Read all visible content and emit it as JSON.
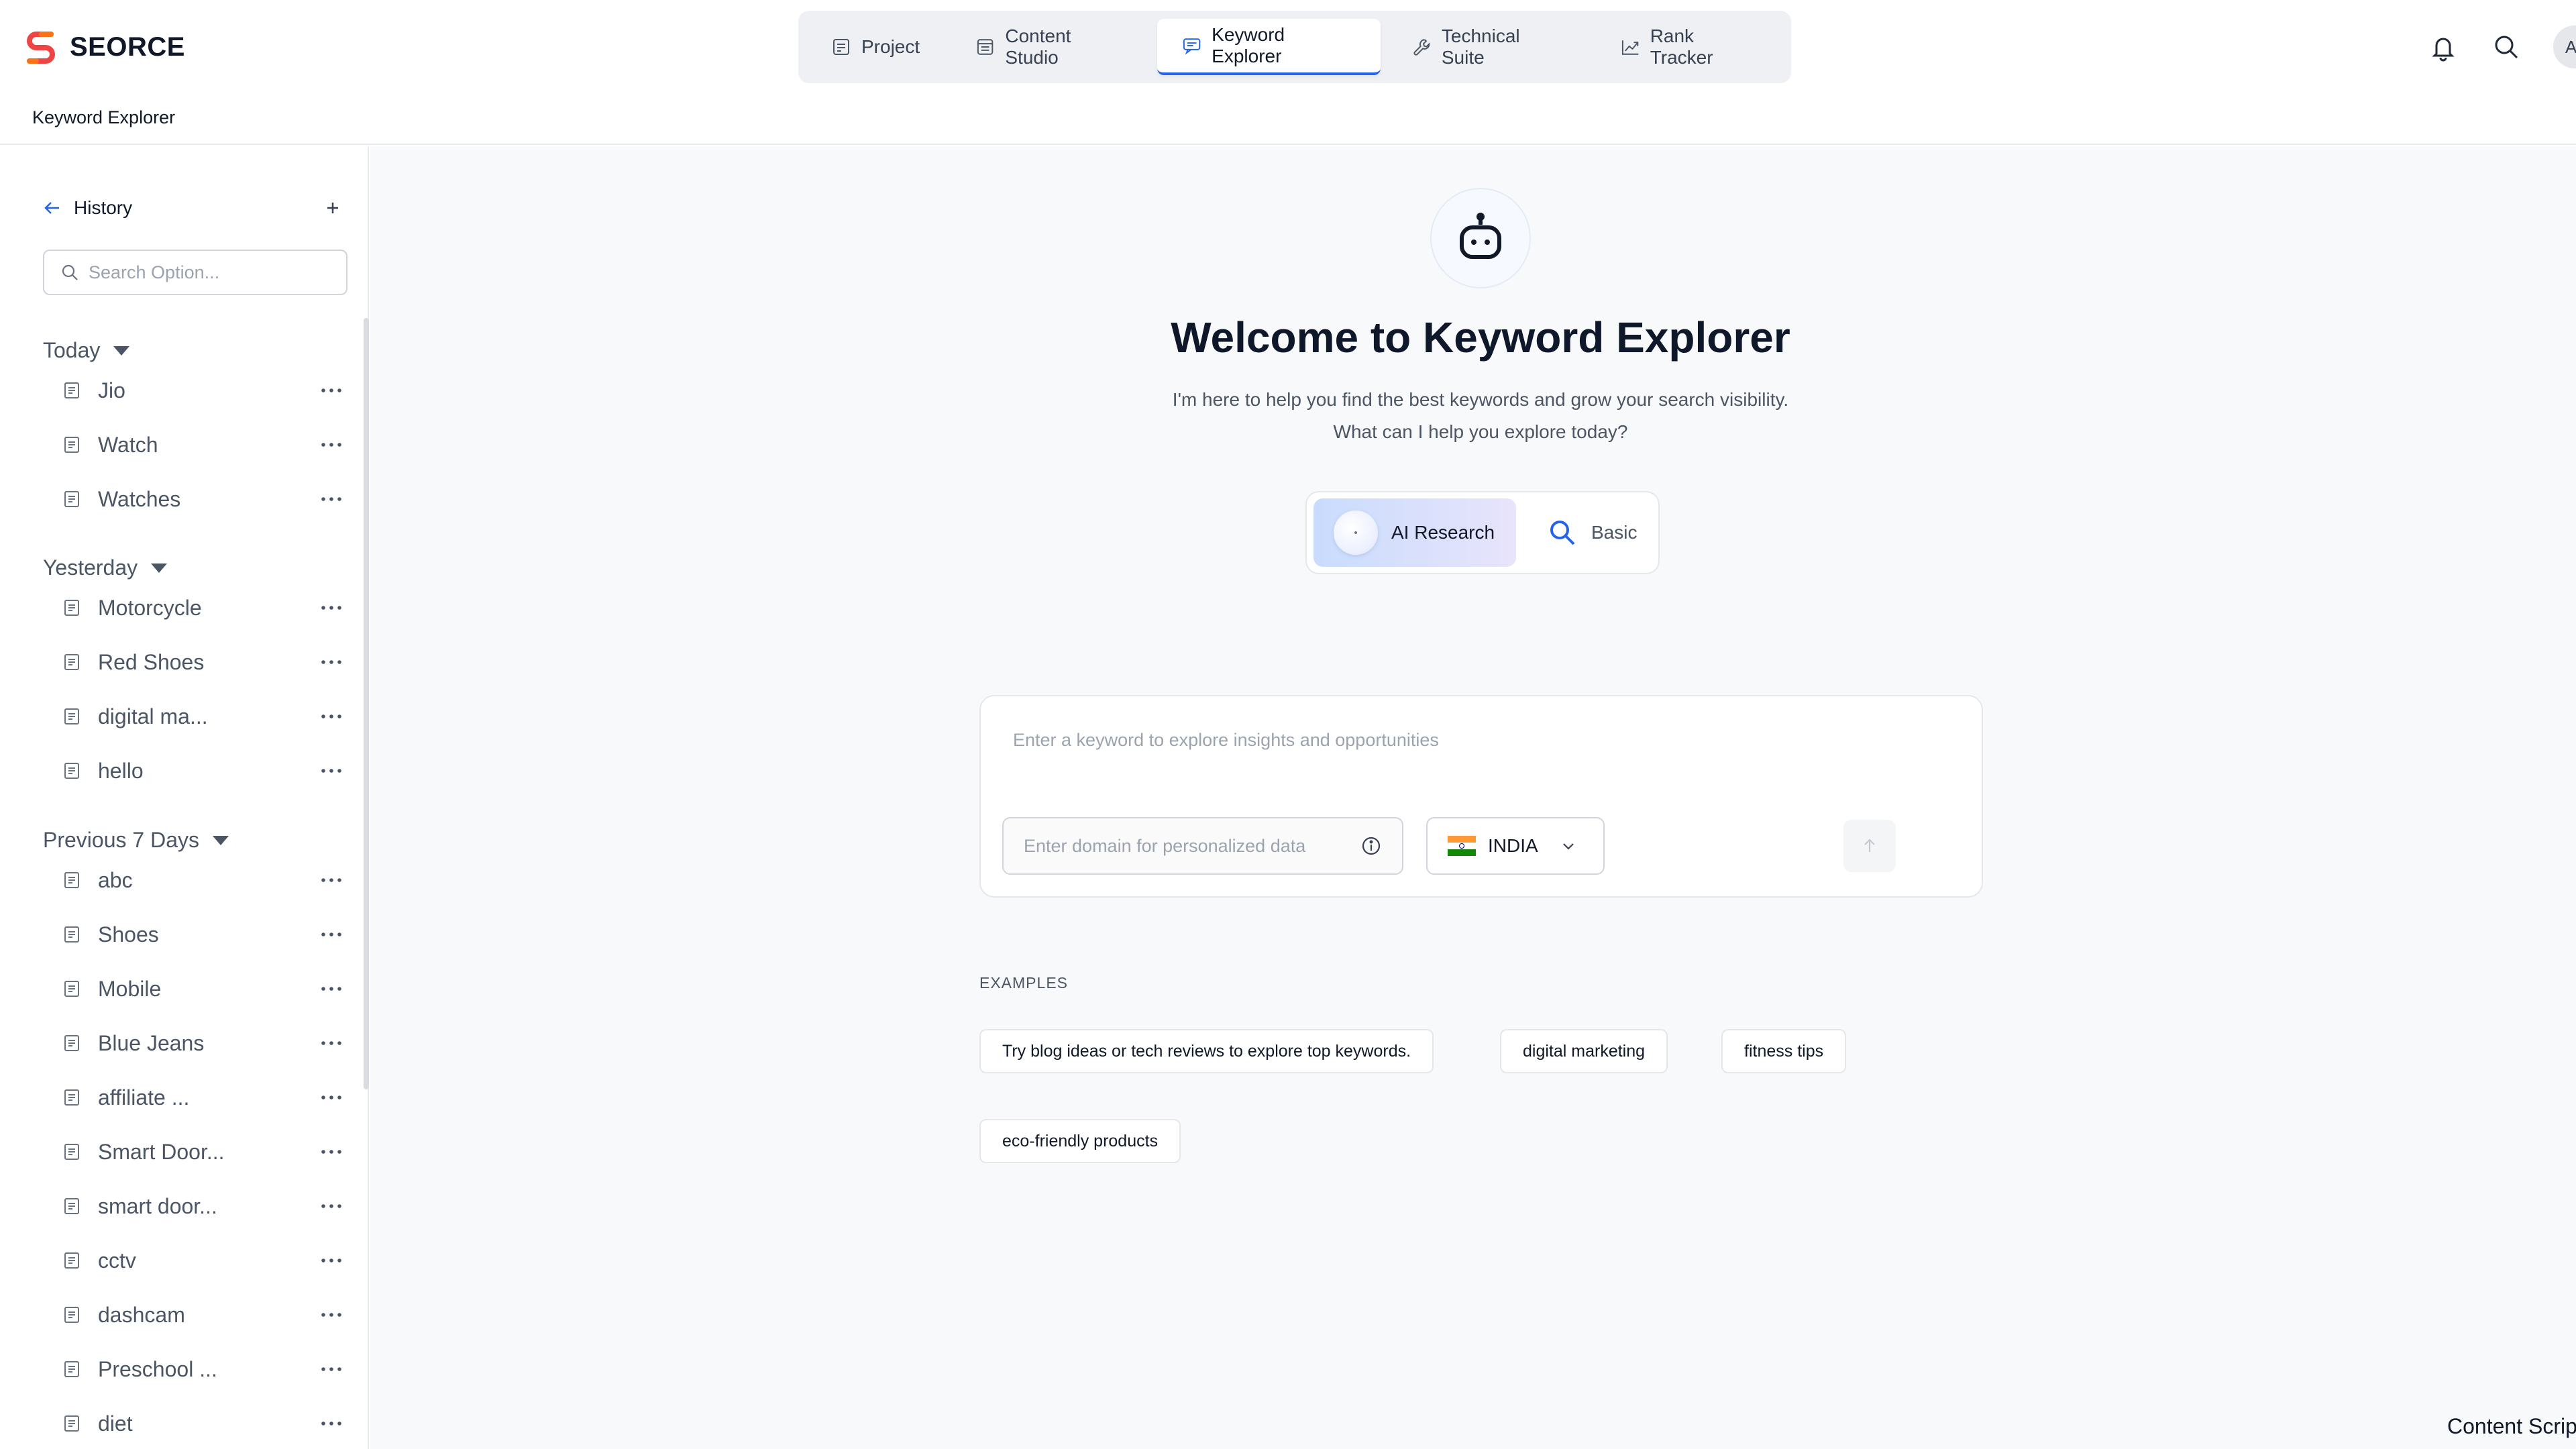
{
  "app": {
    "brand": "SEORCE",
    "breadcrumb": "Keyword Explorer",
    "avatar_initials": "AN"
  },
  "nav": {
    "tabs": [
      {
        "label": "Project",
        "icon": "project-icon"
      },
      {
        "label": "Content Studio",
        "icon": "content-studio-icon"
      },
      {
        "label": "Keyword Explorer",
        "icon": "keyword-explorer-icon",
        "active": true
      },
      {
        "label": "Technical Suite",
        "icon": "wrench-icon"
      },
      {
        "label": "Rank Tracker",
        "icon": "trend-icon"
      }
    ]
  },
  "sidebar": {
    "title": "History",
    "search_placeholder": "Search Option...",
    "groups": [
      {
        "title": "Today",
        "items": [
          "Jio",
          "Watch",
          "Watches"
        ]
      },
      {
        "title": "Yesterday",
        "items": [
          "Motorcycle",
          "Red Shoes",
          "digital ma...",
          "hello"
        ]
      },
      {
        "title": "Previous 7 Days",
        "items": [
          "abc",
          "Shoes",
          "Mobile",
          "Blue Jeans",
          "affiliate ...",
          "Smart Door...",
          "smart door...",
          "cctv",
          "dashcam",
          "Preschool ...",
          "diet"
        ]
      }
    ]
  },
  "main": {
    "welcome_title": "Welcome to Keyword Explorer",
    "subtitle_line1": "I'm here to help you find the best keywords and grow your search visibility.",
    "subtitle_line2": "What can I help you explore today?",
    "modes": {
      "ai": "AI Research",
      "basic": "Basic"
    },
    "query_placeholder": "Enter a keyword to explore insights and opportunities",
    "domain_placeholder": "Enter domain for personalized data",
    "country": "INDIA",
    "examples_label": "EXAMPLES",
    "examples": [
      "Try blog ideas or tech reviews to explore top keywords.",
      "digital marketing",
      "fitness tips",
      "eco-friendly products"
    ]
  },
  "footer_text": "Content Script",
  "colors": {
    "accent": "#2563eb",
    "brand_red": "#ef4444",
    "brand_orange": "#f97316",
    "flag_saffron": "#ff9933",
    "flag_green": "#138808",
    "flag_navy": "#000080"
  }
}
